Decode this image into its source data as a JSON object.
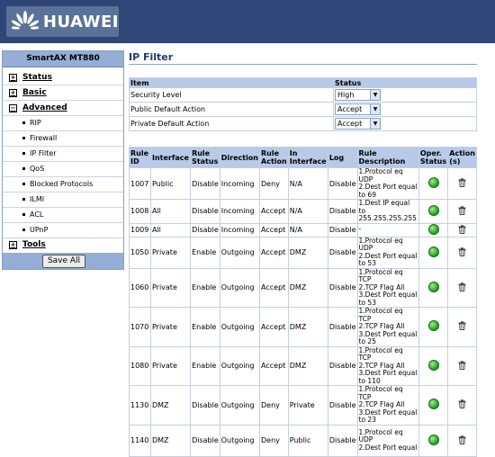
{
  "brand": "HUAWEI",
  "colors": {
    "header": "#2e4778",
    "table_header": "#b7cae7",
    "title": "#223a6a",
    "status_ok": "#2fae2f"
  },
  "sidebar": {
    "model": "SmartAX MT880",
    "status": "Status",
    "basic": "Basic",
    "advanced": "Advanced",
    "items": [
      "RIP",
      "Firewall",
      "IP Filter",
      "QoS",
      "Blocked Protocols",
      "ILMI",
      "ACL",
      "UPnP"
    ],
    "tools": "Tools",
    "save_label": "Save All"
  },
  "page": {
    "title": "IP Filter",
    "settings_headers": {
      "item": "Item",
      "status": "Status"
    },
    "settings": [
      {
        "label": "Security Level",
        "value": "High"
      },
      {
        "label": "Public Default Action",
        "value": "Accept"
      },
      {
        "label": "Private Default Action",
        "value": "Accept"
      }
    ],
    "rule_headers": {
      "rule_id": "Rule ID",
      "interface": "Interface",
      "rule_status": "Rule Status",
      "direction": "Direction",
      "rule_action": "Rule Action",
      "in_interface": "In Interface",
      "log": "Log",
      "rule_description": "Rule Description",
      "oper_status": "Oper. Status",
      "actions": "Action (s)"
    },
    "rules": [
      {
        "id": "1007",
        "interface": "Public",
        "status": "Disable",
        "direction": "Incoming",
        "action": "Deny",
        "in_interface": "N/A",
        "log": "Disable",
        "desc": [
          "1.Protocol eq UDP",
          "2.Dest Port equal to 69"
        ]
      },
      {
        "id": "1008",
        "interface": "All",
        "status": "Disable",
        "direction": "Incoming",
        "action": "Accept",
        "in_interface": "N/A",
        "log": "Disable",
        "desc": [
          "1.Dest IP equal to",
          "255.255.255.255"
        ]
      },
      {
        "id": "1009",
        "interface": "All",
        "status": "Disable",
        "direction": "Incoming",
        "action": "Accept",
        "in_interface": "N/A",
        "log": "Disable",
        "desc": [
          "-"
        ]
      },
      {
        "id": "1050",
        "interface": "Private",
        "status": "Enable",
        "direction": "Outgoing",
        "action": "Accept",
        "in_interface": "DMZ",
        "log": "Disable",
        "desc": [
          "1.Protocol eq UDP",
          "2.Dest Port equal to 53"
        ]
      },
      {
        "id": "1060",
        "interface": "Private",
        "status": "Enable",
        "direction": "Outgoing",
        "action": "Accept",
        "in_interface": "DMZ",
        "log": "Disable",
        "desc": [
          "1.Protocol eq TCP",
          "2.TCP Flag All",
          "3.Dest Port equal to 53"
        ]
      },
      {
        "id": "1070",
        "interface": "Private",
        "status": "Enable",
        "direction": "Outgoing",
        "action": "Accept",
        "in_interface": "DMZ",
        "log": "Disable",
        "desc": [
          "1.Protocol eq TCP",
          "2.TCP Flag All",
          "3.Dest Port equal to 25"
        ]
      },
      {
        "id": "1080",
        "interface": "Private",
        "status": "Enable",
        "direction": "Outgoing",
        "action": "Accept",
        "in_interface": "DMZ",
        "log": "Disable",
        "desc": [
          "1.Protocol eq TCP",
          "2.TCP Flag All",
          "3.Dest Port equal to 110"
        ]
      },
      {
        "id": "1130",
        "interface": "DMZ",
        "status": "Disable",
        "direction": "Outgoing",
        "action": "Deny",
        "in_interface": "Private",
        "log": "Disable",
        "desc": [
          "1.Protocol eq TCP",
          "2.TCP Flag All",
          "3.Dest Port equal to 23"
        ]
      },
      {
        "id": "1140",
        "interface": "DMZ",
        "status": "Disable",
        "direction": "Outgoing",
        "action": "Deny",
        "in_interface": "Public",
        "log": "Disable",
        "desc": [
          "1.Protocol eq UDP",
          "2.Dest Port equal"
        ]
      }
    ]
  }
}
